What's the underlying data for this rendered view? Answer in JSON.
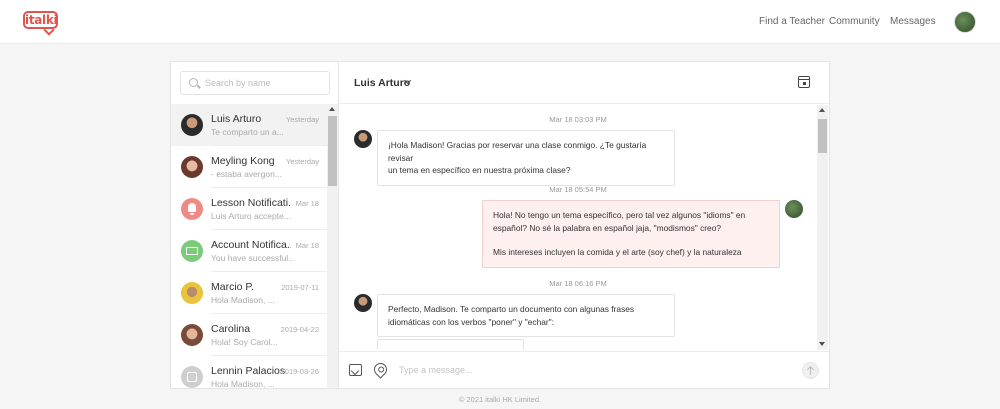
{
  "brand": {
    "logo_text": "italki",
    "accent": "#e2554e"
  },
  "nav": {
    "find_teacher": "Find a Teacher",
    "community": "Community",
    "messages": "Messages"
  },
  "sidebar": {
    "search_placeholder": "Search by name",
    "conversations": [
      {
        "name": "Luis Arturo",
        "date": "Yesterday",
        "snippet": "Te comparto un a...",
        "avatar": "photo-man"
      },
      {
        "name": "Meyling Kong",
        "date": "Yesterday",
        "snippet": "- estaba avergon...",
        "avatar": "photo-woman"
      },
      {
        "name": "Lesson Notificati...",
        "date": "Mar 18",
        "snippet": "Luis Arturo accepte...",
        "avatar": "bell-icon"
      },
      {
        "name": "Account Notifica...",
        "date": "Mar 18",
        "snippet": "You have successful...",
        "avatar": "ticket-icon"
      },
      {
        "name": "Marcio P.",
        "date": "2019-07-11",
        "snippet": "Hola Madison, ...",
        "avatar": "photo-man-2"
      },
      {
        "name": "Carolina",
        "date": "2019-04-22",
        "snippet": "Hola! Soy Carol...",
        "avatar": "photo-woman-2"
      },
      {
        "name": "Lennin Palacios",
        "date": "2019-03-26",
        "snippet": "Hola Madison, ...",
        "avatar": "placeholder-avatar"
      }
    ]
  },
  "chat": {
    "contact_name": "Luis Arturo",
    "timestamps": [
      "Mar 18 03:03 PM",
      "Mar 18 05:54 PM",
      "Mar 18 06:16 PM"
    ],
    "messages": [
      {
        "from": "them",
        "lines": [
          "¡Hola Madison! Gracias por reservar una clase conmigo. ¿Te gustaría revisar",
          "un tema en específico en nuestra próxima clase?"
        ]
      },
      {
        "from": "me",
        "paragraphs": [
          "Hola! No tengo un tema específico, pero tal vez algunos \"idioms\" en español? No sé la palabra en español jaja, \"modismos\" creo?",
          "Mis intereses incluyen la comida y el arte (soy chef) y la naturaleza"
        ]
      },
      {
        "from": "them",
        "lines": [
          "Perfecto, Madison. Te comparto un documento con algunas frases",
          "idiomáticas con los verbos \"poner\" y \"echar\":"
        ]
      }
    ],
    "composer_placeholder": "Type a message..."
  },
  "footer": {
    "copyright": "© 2021 italki HK Limited."
  }
}
